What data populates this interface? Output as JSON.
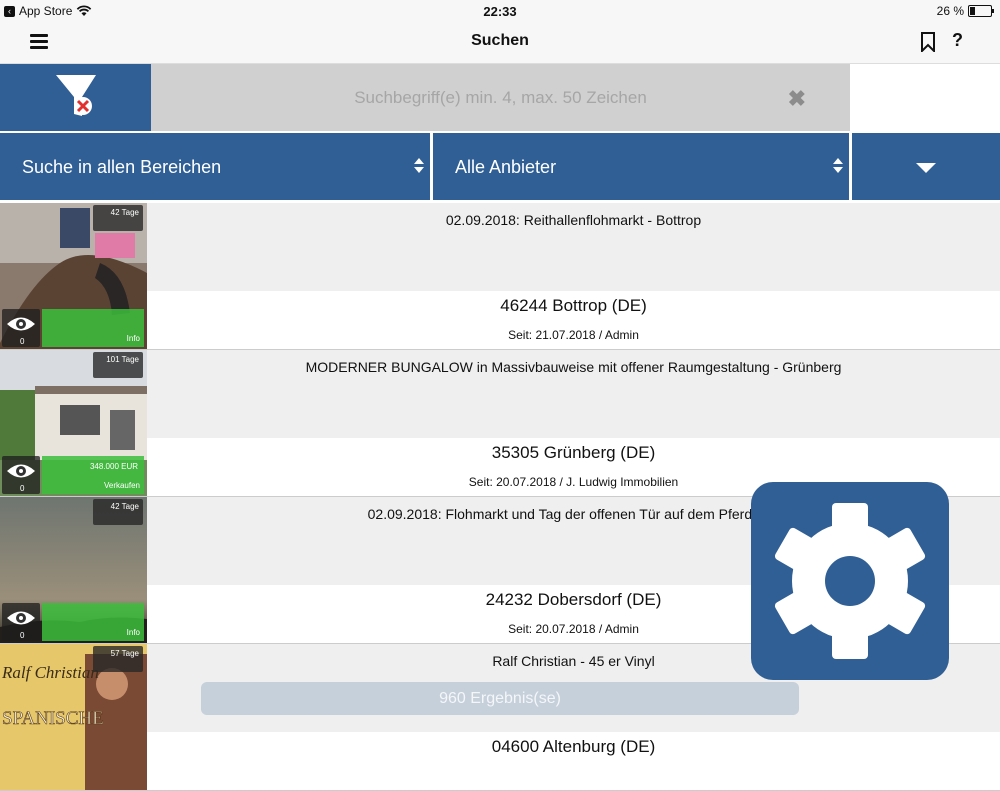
{
  "status_bar": {
    "back_app": "App Store",
    "time": "22:33",
    "battery_text": "26 %",
    "battery_level": 0.26
  },
  "nav": {
    "title": "Suchen"
  },
  "search": {
    "placeholder": "Suchbegriff(e) min. 4, max. 50 Zeichen",
    "value": ""
  },
  "filters": {
    "area": "Suche in allen Bereichen",
    "provider": "Alle Anbieter"
  },
  "results": [
    {
      "days": "42 Tage",
      "views": "0",
      "badge": "Info",
      "title": "02.09.2018: Reithallenflohmarkt - Bottrop",
      "location": "46244 Bottrop (DE)",
      "since": "Seit: 21.07.2018 / Admin"
    },
    {
      "days": "101 Tage",
      "views": "0",
      "price": "348.000 EUR",
      "badge": "Verkaufen",
      "title": "MODERNER BUNGALOW in Massivbauweise mit offener Raumgestaltung - Grünberg",
      "location": "35305 Grünberg (DE)",
      "since": "Seit: 20.07.2018 / J. Ludwig Immobilien"
    },
    {
      "days": "42 Tage",
      "views": "0",
      "badge": "Info",
      "title": "02.09.2018: Flohmarkt und Tag der offenen Tür auf dem Pferdehof",
      "location": "24232 Dobersdorf (DE)",
      "since": "Seit: 20.07.2018 / Admin"
    },
    {
      "days": "57 Tage",
      "title": "Ralf Christian - 45 er Vinyl",
      "location": "04600 Altenburg (DE)",
      "cover_text_1": "Ralf Christian",
      "cover_text_2": "SPANISCHE"
    }
  ],
  "result_count": "960 Ergebnis(se)",
  "icons": {
    "menu": "hamburger-icon",
    "bookmark": "bookmark-icon",
    "help": "help-icon",
    "filter": "filter-clear-icon",
    "clear": "close-icon",
    "views": "eye-icon",
    "settings": "gear-icon"
  },
  "colors": {
    "primary": "#2f5f95",
    "green": "#3cbe3c",
    "search_bg": "#d0d0d0"
  }
}
